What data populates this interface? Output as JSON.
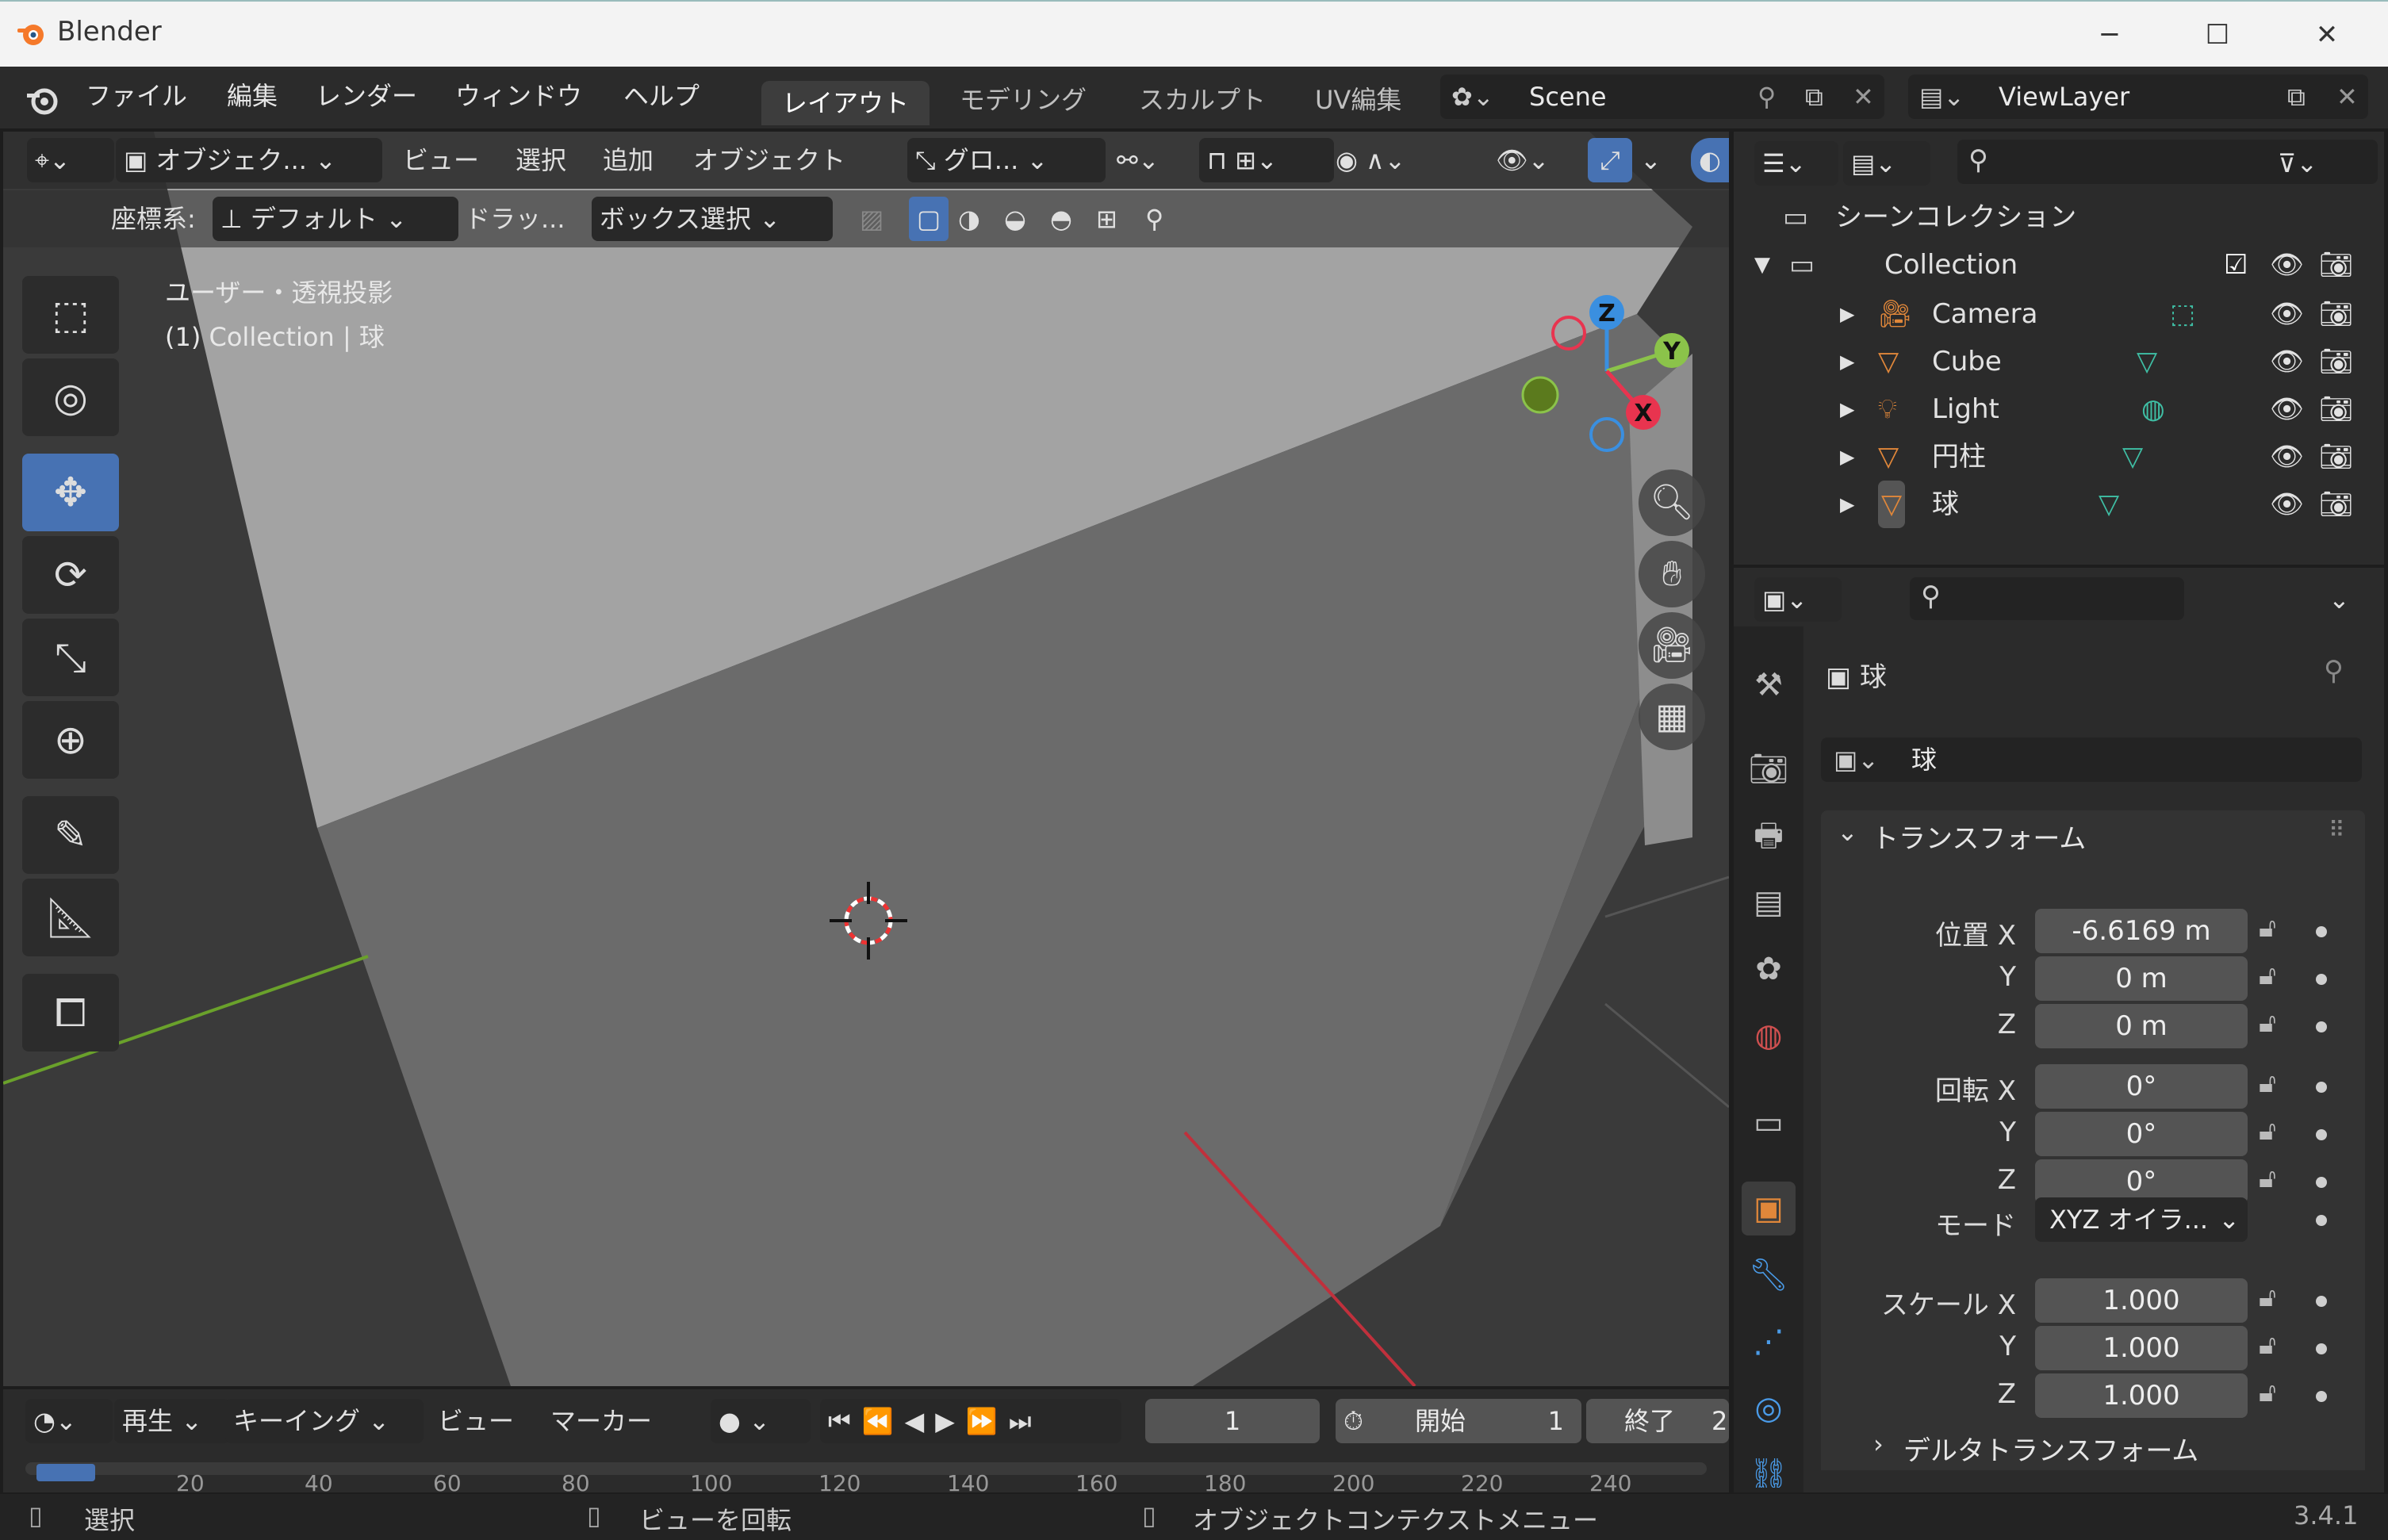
{
  "window": {
    "title": "Blender",
    "minimize": "─",
    "maximize": "☐",
    "close": "✕"
  },
  "menu": {
    "items": [
      "ファイル",
      "編集",
      "レンダー",
      "ウィンドウ",
      "ヘルプ"
    ]
  },
  "workspaces": {
    "tabs": [
      "レイアウト",
      "モデリング",
      "スカルプト",
      "UV編集"
    ],
    "active": "レイアウト"
  },
  "scene": {
    "name": "Scene"
  },
  "viewlayer": {
    "name": "ViewLayer"
  },
  "viewport_header": {
    "mode": "オブジェク...",
    "menus": [
      "ビュー",
      "選択",
      "追加",
      "オブジェクト"
    ],
    "transform_orientation": "グロ..."
  },
  "tool_header": {
    "coord_label": "座標系:",
    "coord_value": "デフォルト",
    "drag_label": "ドラッ...",
    "drag_value": "ボックス選択"
  },
  "viewport": {
    "view_name": "ユーザー・透視投影",
    "context": "(1) Collection | 球",
    "gizmo": {
      "x": "X",
      "y": "Y",
      "z": "Z"
    }
  },
  "timeline": {
    "playback": "再生",
    "keying": "キーイング",
    "view": "ビュー",
    "marker": "マーカー",
    "current_frame": "1",
    "start_label": "開始",
    "start_value": "1",
    "end_label": "終了",
    "end_value": "2",
    "ruler": [
      "20",
      "40",
      "60",
      "80",
      "100",
      "120",
      "140",
      "160",
      "180",
      "200",
      "220",
      "240"
    ]
  },
  "status": {
    "left": "選択",
    "middle": "ビューを回転",
    "right": "オブジェクトコンテクストメニュー",
    "version": "3.4.1"
  },
  "outliner": {
    "scene_collection": "シーンコレクション",
    "collection": "Collection",
    "objects": [
      "Camera",
      "Cube",
      "Light",
      "円柱",
      "球"
    ]
  },
  "properties": {
    "object_name": "球",
    "datablock_name": "球",
    "panel_transform": "トランスフォーム",
    "location_label": "位置 X",
    "rotation_label": "回転 X",
    "scale_label": "スケール X",
    "axis_y": "Y",
    "axis_z": "Z",
    "location": [
      "-6.6169 m",
      "0 m",
      "0 m"
    ],
    "rotation": [
      "0°",
      "0°",
      "0°"
    ],
    "mode_label": "モード",
    "mode_value": "XYZ オイラ...",
    "scale": [
      "1.000",
      "1.000",
      "1.000"
    ],
    "panel_delta": "デルタトランスフォーム"
  },
  "colors": {
    "accent": "#4772b3",
    "axis_x": "#e8344f",
    "axis_y": "#8bc34a",
    "axis_z": "#3a8fe0",
    "object_orange": "#e0873a"
  }
}
